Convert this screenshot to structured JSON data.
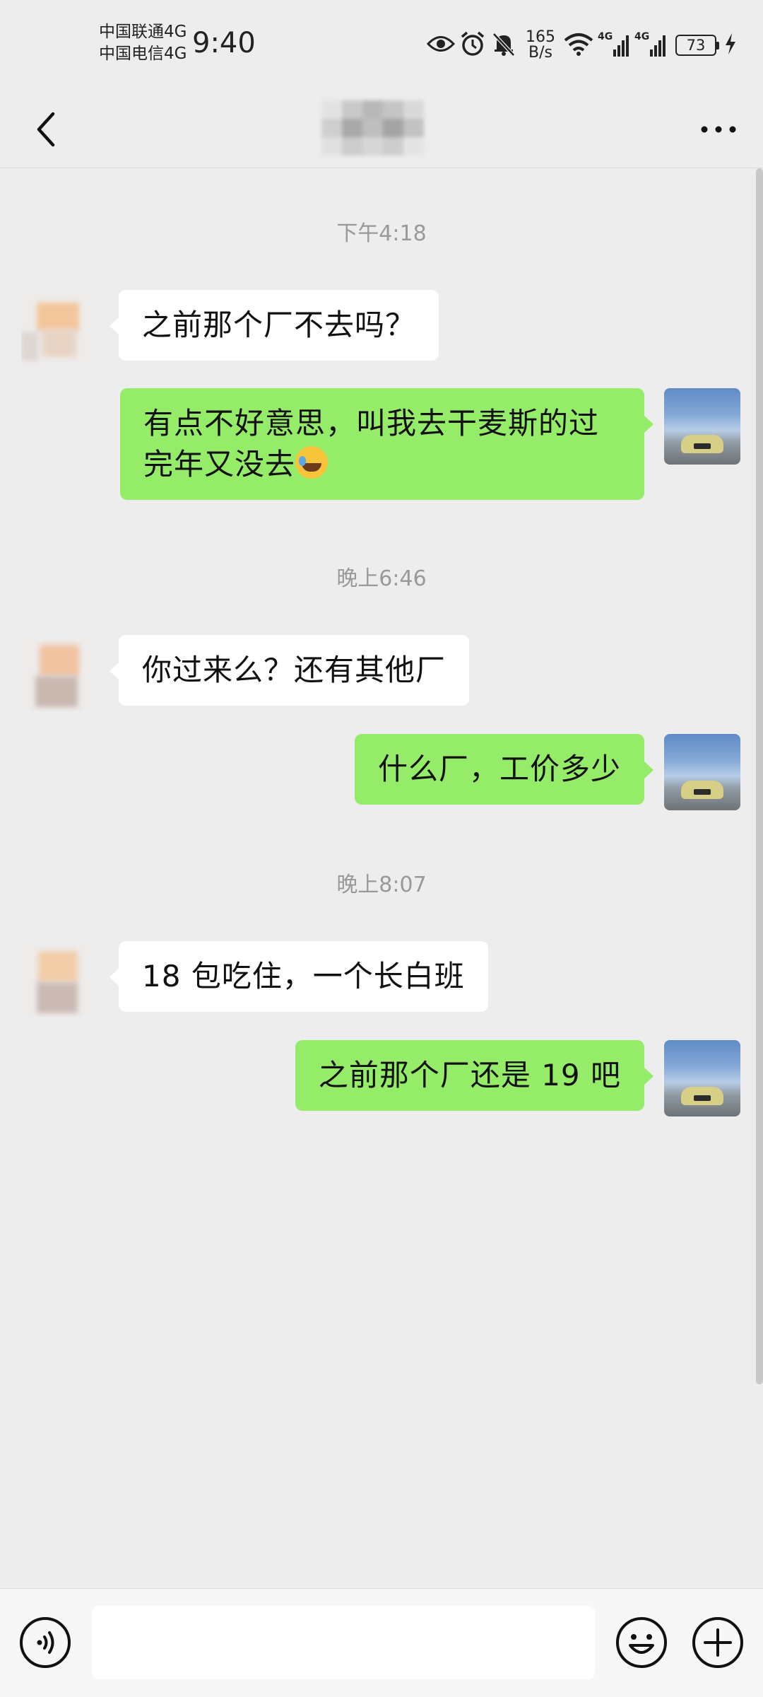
{
  "status_bar": {
    "carrier_1": "中国联通4G",
    "carrier_2": "中国电信4G",
    "time": "9:40",
    "net_speed_value": "165",
    "net_speed_unit": "B/s",
    "network_1": "4G",
    "network_2": "4G",
    "battery_level": "73",
    "icons": [
      "eye-icon",
      "alarm-icon",
      "mute-bell-icon",
      "wifi-icon",
      "signal-icon",
      "signal-icon",
      "charging-icon"
    ]
  },
  "header": {
    "back_icon": "back-chevron-icon",
    "more_icon": "more-dots-icon"
  },
  "messages": [
    {
      "type": "timestamp",
      "text": "下午4:18"
    },
    {
      "type": "incoming",
      "text": "之前那个厂不去吗？"
    },
    {
      "type": "outgoing",
      "text": "有点不好意思，叫我去干麦斯的过完年又没去",
      "emoji": "rofl-emoji"
    },
    {
      "type": "timestamp",
      "text": "晚上6:46"
    },
    {
      "type": "incoming",
      "text": "你过来么？还有其他厂"
    },
    {
      "type": "outgoing",
      "text": "什么厂，工价多少"
    },
    {
      "type": "timestamp",
      "text": "晚上8:07"
    },
    {
      "type": "incoming",
      "text": "18 包吃住，一个长白班"
    },
    {
      "type": "outgoing",
      "text": "之前那个厂还是 19 吧"
    }
  ],
  "input_bar": {
    "value": "",
    "voice_icon": "voice-icon",
    "emoji_icon": "emoji-icon",
    "plus_icon": "plus-icon"
  },
  "colors": {
    "background": "#ededed",
    "outgoing_bubble": "#95ec69",
    "incoming_bubble": "#ffffff",
    "timestamp_text": "#999999"
  }
}
